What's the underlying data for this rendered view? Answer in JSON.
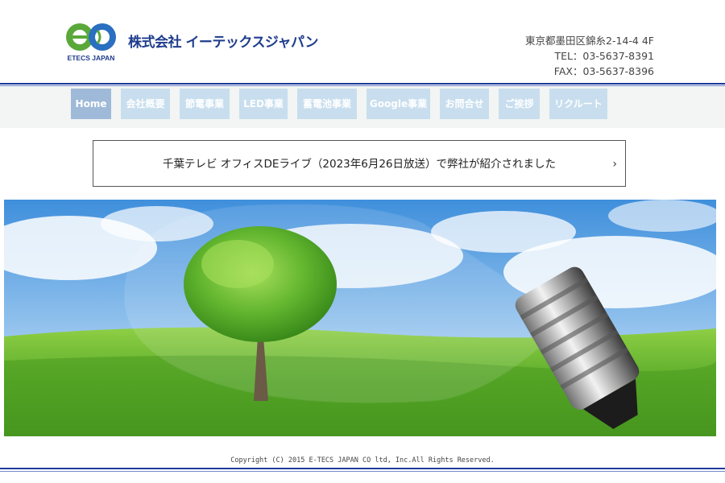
{
  "header": {
    "company_name": "株式会社 イーテックスジャパン",
    "logo_text": "ETECS JAPAN",
    "address": "東京都墨田区錦糸2-14-4 4F",
    "tel": "TEL：03-5637-8391",
    "fax": "FAX：03-5637-8396"
  },
  "nav": {
    "items": [
      {
        "label": "Home"
      },
      {
        "label": "会社概要"
      },
      {
        "label": "節電事業"
      },
      {
        "label": "LED事業"
      },
      {
        "label": "蓄電池事業"
      },
      {
        "label": "Google事業"
      },
      {
        "label": "お問合せ"
      },
      {
        "label": "ご挨拶"
      },
      {
        "label": "リクルート"
      }
    ]
  },
  "news": {
    "text": "千葉テレビ オフィスDEライブ（2023年6月26日放送）で弊社が紹介されました",
    "arrow": "›"
  },
  "footer": {
    "copyright": "Copyright (C) 2015 E-TECS JAPAN CO ltd, Inc.All Rights Reserved."
  },
  "colors": {
    "brand_blue": "#1e3c8c",
    "nav_bg": "#c8deee",
    "nav_active": "#9fbad8",
    "rule": "#1d3a9a"
  }
}
